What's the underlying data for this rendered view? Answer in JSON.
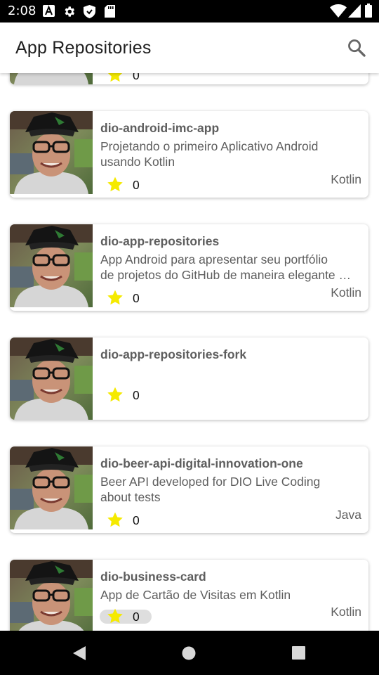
{
  "status_bar": {
    "time": "2:08",
    "left_icons": [
      "font-a-icon",
      "settings-gear-icon",
      "shield-icon",
      "sd-card-icon"
    ],
    "right_icons": [
      "wifi-icon",
      "signal-icon",
      "battery-icon"
    ]
  },
  "app_bar": {
    "title": "App Repositories",
    "search_icon": "search-icon"
  },
  "colors": {
    "status_bar": "#000000",
    "app_bar": "#ffffff",
    "star": "#f5ea00",
    "text": "#5e5e5e",
    "nav_bar": "#000000"
  },
  "repos": [
    {
      "stars": "0"
    },
    {
      "name": "dio-android-imc-app",
      "description_lines": [
        "Projetando o primeiro Aplicativo Android",
        "usando Kotlin"
      ],
      "stars": "0",
      "language": "Kotlin"
    },
    {
      "name": "dio-app-repositories",
      "description_lines": [
        "App Android para apresentar seu portfólio",
        "de projetos do GitHub de maneira elegante …"
      ],
      "stars": "0",
      "language": "Kotlin"
    },
    {
      "name": "dio-app-repositories-fork",
      "description_lines": [],
      "stars": "0",
      "language": ""
    },
    {
      "name": "dio-beer-api-digital-innovation-one",
      "description_lines": [
        "Beer API developed for DIO Live Coding",
        "about tests"
      ],
      "stars": "0",
      "language": "Java"
    },
    {
      "name": "dio-business-card",
      "description_lines": [
        "App de Cartão de Visitas em Kotlin"
      ],
      "stars": "0",
      "language": "Kotlin"
    }
  ],
  "nav_bar": {
    "buttons": [
      "back-icon",
      "home-icon",
      "recents-icon"
    ]
  }
}
